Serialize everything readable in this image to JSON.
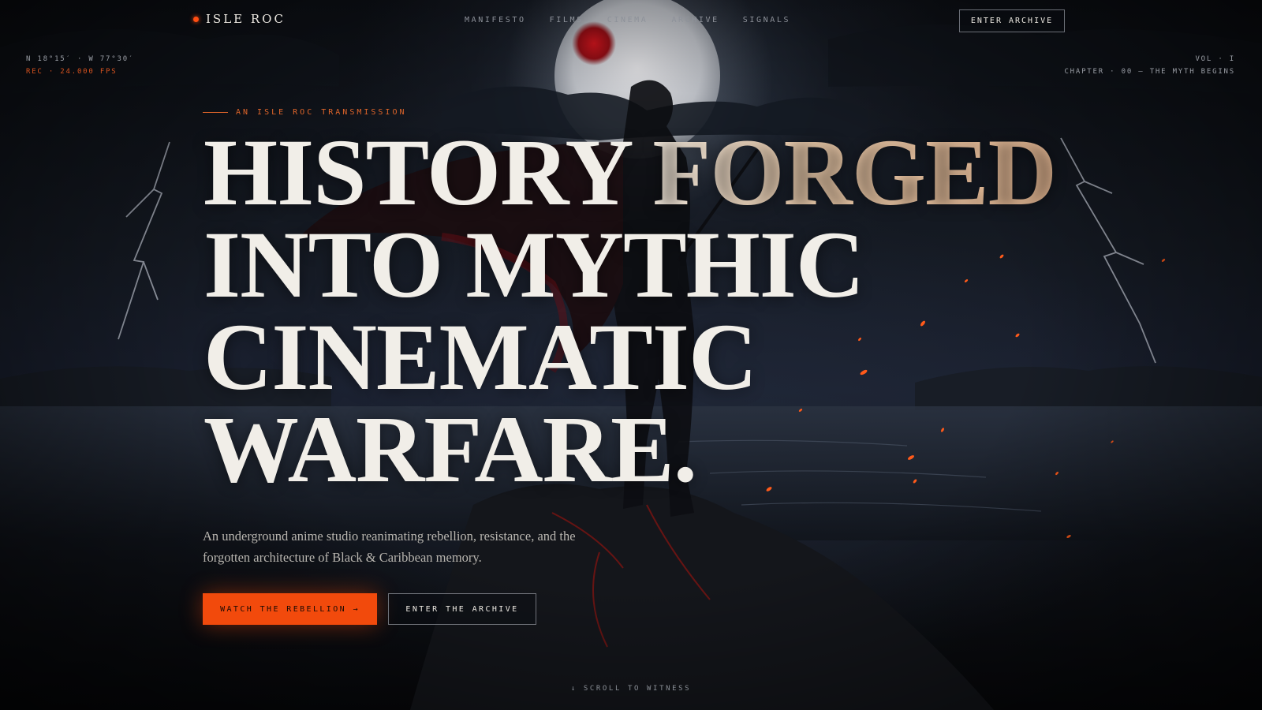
{
  "brand": {
    "name": "ISLE ROC"
  },
  "nav": {
    "items": [
      {
        "label": "MANIFESTO"
      },
      {
        "label": "FILMS"
      },
      {
        "label": "CINEMA"
      },
      {
        "label": "ARCHIVE"
      },
      {
        "label": "SIGNALS"
      }
    ],
    "cta_label": "ENTER ARCHIVE"
  },
  "meta_left": {
    "coords": "N 18°15′ · W 77°30′",
    "rec": "REC · 24.000 FPS"
  },
  "meta_right": {
    "volume": "VOL · I",
    "chapter": "CHAPTER · 00 — THE MYTH BEGINS"
  },
  "hero": {
    "eyebrow": "AN ISLE ROC TRANSMISSION",
    "headline": {
      "line1_a": "HISTORY ",
      "line1_b": "FORGED",
      "line2": "INTO MYTHIC",
      "line3": "CINEMATIC",
      "line4": "WARFARE."
    },
    "subtitle": "An underground anime studio reanimating rebellion, resistance, and the forgotten architecture of Black & Caribbean memory.",
    "primary_cta": "WATCH THE REBELLION →",
    "secondary_cta": "ENTER THE ARCHIVE"
  },
  "scroll_hint": "↓ SCROLL TO WITNESS",
  "colors": {
    "accent": "#f24a0c",
    "background": "#0b0d12",
    "headline": "#f1eee8",
    "headline_warm": "#f0cfae"
  }
}
